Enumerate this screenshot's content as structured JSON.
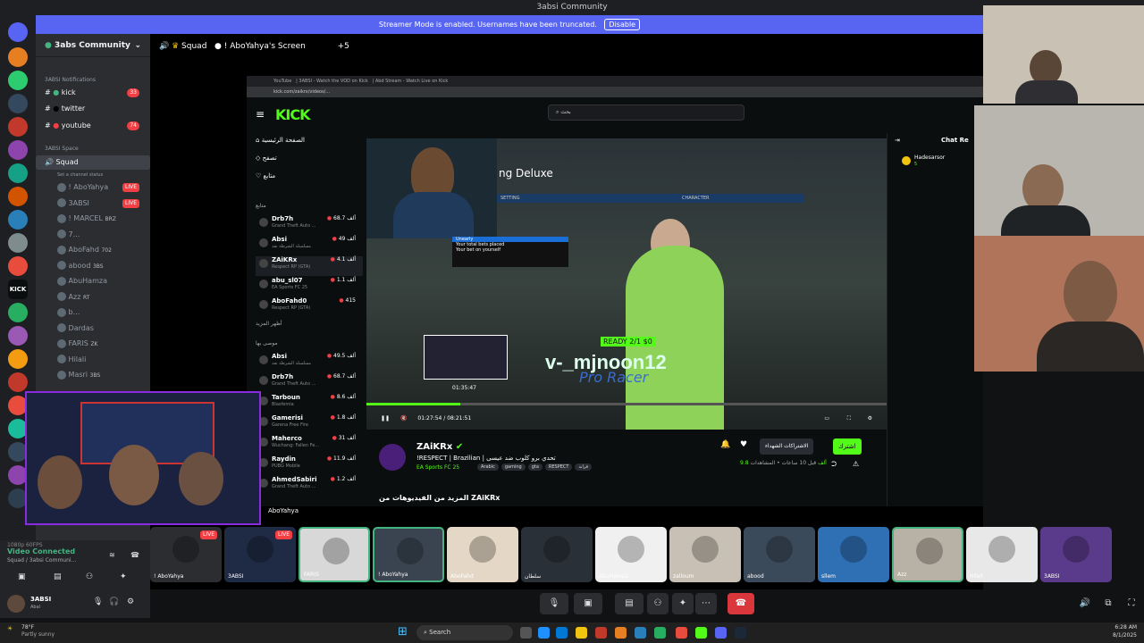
{
  "window": {
    "title": "3absi Community"
  },
  "banner": {
    "text": "Streamer Mode is enabled. Usernames have been truncated.",
    "button": "Disable"
  },
  "server": {
    "name": "3abs Community"
  },
  "channels": {
    "category1": "3ABSI Notifications",
    "items": [
      {
        "name": "kick",
        "badge": "33"
      },
      {
        "name": "twitter",
        "badge": ""
      },
      {
        "name": "youtube",
        "badge": "74"
      }
    ],
    "category2": "3ABSI Space",
    "voice_channel": "Squad",
    "voice_status": "Set a channel status",
    "members": [
      {
        "name": "! AboYahya",
        "tag": "LIVE"
      },
      {
        "name": "3ABSI",
        "tag": "LIVE"
      },
      {
        "name": "! MARCEL",
        "tag": "BRZ"
      },
      {
        "name": "7..."
      },
      {
        "name": "AboFahd",
        "tag": "702"
      },
      {
        "name": "abood",
        "tag": "3BS"
      },
      {
        "name": "AbuHamza"
      },
      {
        "name": "Azz",
        "tag": "RT"
      },
      {
        "name": "b..."
      },
      {
        "name": "Dardas"
      },
      {
        "name": "FARIS",
        "tag": "ZK"
      },
      {
        "name": "Hilali"
      },
      {
        "name": "Masri",
        "tag": "3BS"
      }
    ]
  },
  "voice_header": {
    "channel": "Squad",
    "screen": "! AboYahya's Screen",
    "count": "+5"
  },
  "browser": {
    "url": "kick.com/zaikrx/videos/...",
    "tabs": [
      "YouTube",
      "3ABSI - Watch the VOD on Kick",
      "Abd Stream - Watch Live on Kick"
    ]
  },
  "kick": {
    "logo": "KICK",
    "search_placeholder": "بحث",
    "nav": [
      "الصفحة الرئيسية",
      "تصفح",
      "متابع"
    ],
    "section_following": "متابع",
    "following": [
      {
        "name": "Drb7h",
        "game": "Grand Theft Auto ...",
        "viewers": "68.7 ألف"
      },
      {
        "name": "Absi",
        "game": "مسلسلة الشرطة نفذ",
        "viewers": "49 ألف"
      },
      {
        "name": "ZAiKRx",
        "game": "Respect RP (GTA)",
        "viewers": "4.1 ألف"
      },
      {
        "name": "abu_sl07",
        "game": "EA Sports FC 25",
        "viewers": "1.1 ألف"
      },
      {
        "name": "AboFahd0",
        "game": "Respect RP (GTA)",
        "viewers": "415"
      }
    ],
    "more_label": "أظهر المزيد",
    "section_recommended": "موصى بها",
    "recommended": [
      {
        "name": "Absi",
        "game": "مسلسلة الشرطة نفذ",
        "viewers": "49.5 ألف"
      },
      {
        "name": "Drb7h",
        "game": "Grand Theft Auto ...",
        "viewers": "68.7 ألف"
      },
      {
        "name": "Tarboun",
        "game": "Blasfemia",
        "viewers": "8.6 ألف"
      },
      {
        "name": "Gamerisi",
        "game": "Garena Free Fire",
        "viewers": "1.8 ألف"
      },
      {
        "name": "Mahercо",
        "game": "Wuchang: Fallen Fe...",
        "viewers": "31 ألف"
      },
      {
        "name": "Raydin",
        "game": "PUBG Mobile",
        "viewers": "11.9 ألف"
      },
      {
        "name": "AhmedSabiri",
        "game": "Grand Theft Auto ...",
        "viewers": "1.2 ألف"
      }
    ],
    "player": {
      "game_title": "ng Deluxe",
      "player_name": "v-_mjnoon12",
      "player_tag": "Pro Racer",
      "ready": "READY",
      "ratio": "2/1",
      "money": "$0",
      "preview_time": "01:35:47",
      "time_current": "01:27:54",
      "time_total": "08:21:51",
      "progress": 0.18,
      "bets": [
        "Unearly",
        "Your total bets placed",
        "Your bet on yourself"
      ],
      "header_cols": [
        "SETTING",
        "CHARACTER"
      ]
    },
    "stream": {
      "name": "ZAiKRx",
      "title": "!RESPECT | Brazilian | تحدي برو كلوب ضد عيسى",
      "category": "EA Sports FC 25",
      "tags": [
        "Arabic",
        "gaming",
        "gta",
        "RESPECT",
        "قراند"
      ],
      "follow_btn": "اشترك",
      "sub_btn": "الاشتراكات الشهداء",
      "meta": "قبل 10 ساعات • المشاهدات",
      "views": "9.8 ألف",
      "more_videos": "المزيد من الفيديوهات من ZAiKRx"
    },
    "chat": {
      "title": "Chat Re",
      "user": "Hadesarsor",
      "count": "5"
    }
  },
  "tiles": [
    {
      "name": "! AboYahya"
    },
    {
      "name": "3ABSI",
      "live": "LIVE"
    },
    {
      "name": "FARIS"
    },
    {
      "name": "! AboYahya"
    },
    {
      "name": "AboFahd"
    },
    {
      "name": "سلطان"
    },
    {
      "name": "AbuHamza"
    },
    {
      "name": "zalloum"
    },
    {
      "name": "abood"
    },
    {
      "name": "sllem"
    },
    {
      "name": "Azz"
    },
    {
      "name": "Hilali"
    },
    {
      "name": "3ABSI"
    }
  ],
  "tile_live_labels": [
    "LIVE",
    "LIVE"
  ],
  "cam_label": "AboYahya",
  "voice_panel": {
    "status": "Video Connected",
    "channel": "Squad / 3absi Communi...",
    "quality": "1080p 60FPS"
  },
  "user": {
    "name": "3ABSI",
    "status": "Abal"
  },
  "weather": {
    "temp": "78°F",
    "desc": "Partly sunny"
  },
  "taskbar": {
    "search": "Search",
    "time": "6:28 AM",
    "date": "8/1/2025"
  },
  "colors": {
    "kick_green": "#53fc18",
    "discord_blurple": "#5865f2",
    "live_red": "#f23f43"
  }
}
